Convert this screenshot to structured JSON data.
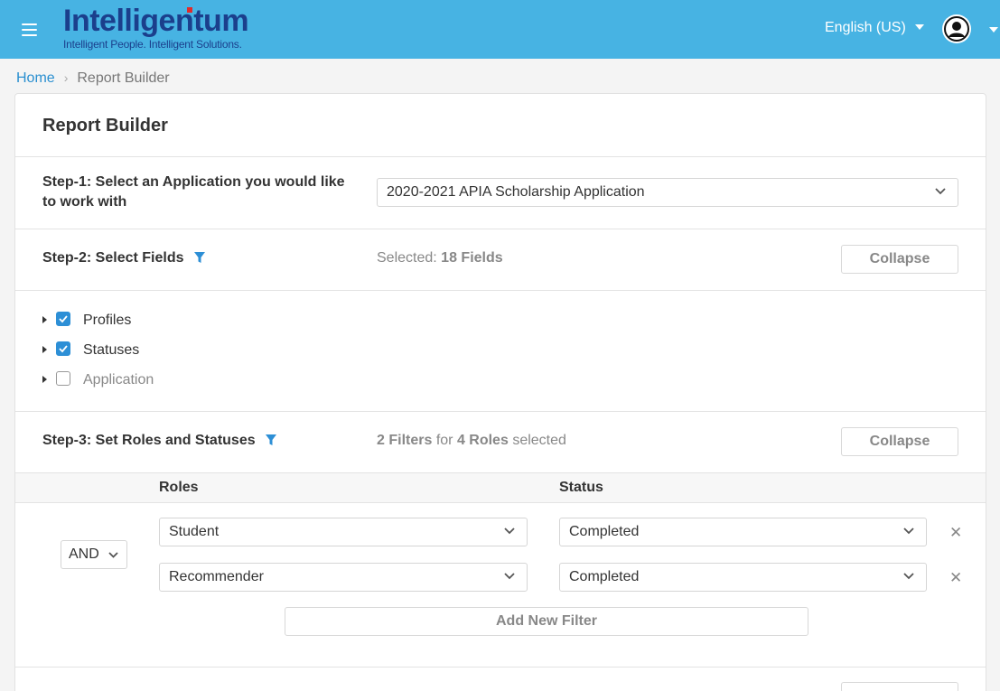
{
  "header": {
    "logo_text": "Intelligentum",
    "logo_tagline": "Intelligent People. Intelligent Solutions.",
    "language": "English (US)",
    "menu_icon": "hamburger-icon",
    "avatar_icon": "user-circle-icon",
    "bg_color": "#47b3e3"
  },
  "breadcrumb": {
    "home": "Home",
    "separator": "›",
    "current": "Report Builder"
  },
  "page": {
    "title": "Report Builder"
  },
  "step1": {
    "label": "Step-1: Select an Application you would like to work with",
    "selected_application": "2020-2021 APIA Scholarship Application"
  },
  "step2": {
    "label": "Step-2: Select Fields",
    "selected_prefix": "Selected:",
    "selected_count": "18 Fields",
    "collapse_label": "Collapse",
    "fields": [
      {
        "label": "Profiles",
        "checked": true
      },
      {
        "label": "Statuses",
        "checked": true
      },
      {
        "label": "Application",
        "checked": false
      }
    ]
  },
  "step3": {
    "label": "Step-3: Set Roles and Statuses",
    "summary_filters": "2 Filters",
    "summary_for": "for",
    "summary_roles": "4 Roles",
    "summary_selected": "selected",
    "collapse_label": "Collapse",
    "roles_header": "Roles",
    "status_header": "Status",
    "operator": "AND",
    "filters": [
      {
        "role": "Student",
        "status": "Completed"
      },
      {
        "role": "Recommender",
        "status": "Completed"
      }
    ],
    "remove_symbol": "✕",
    "add_filter_label": "Add New Filter"
  },
  "accent_color": "#2d8fd6"
}
